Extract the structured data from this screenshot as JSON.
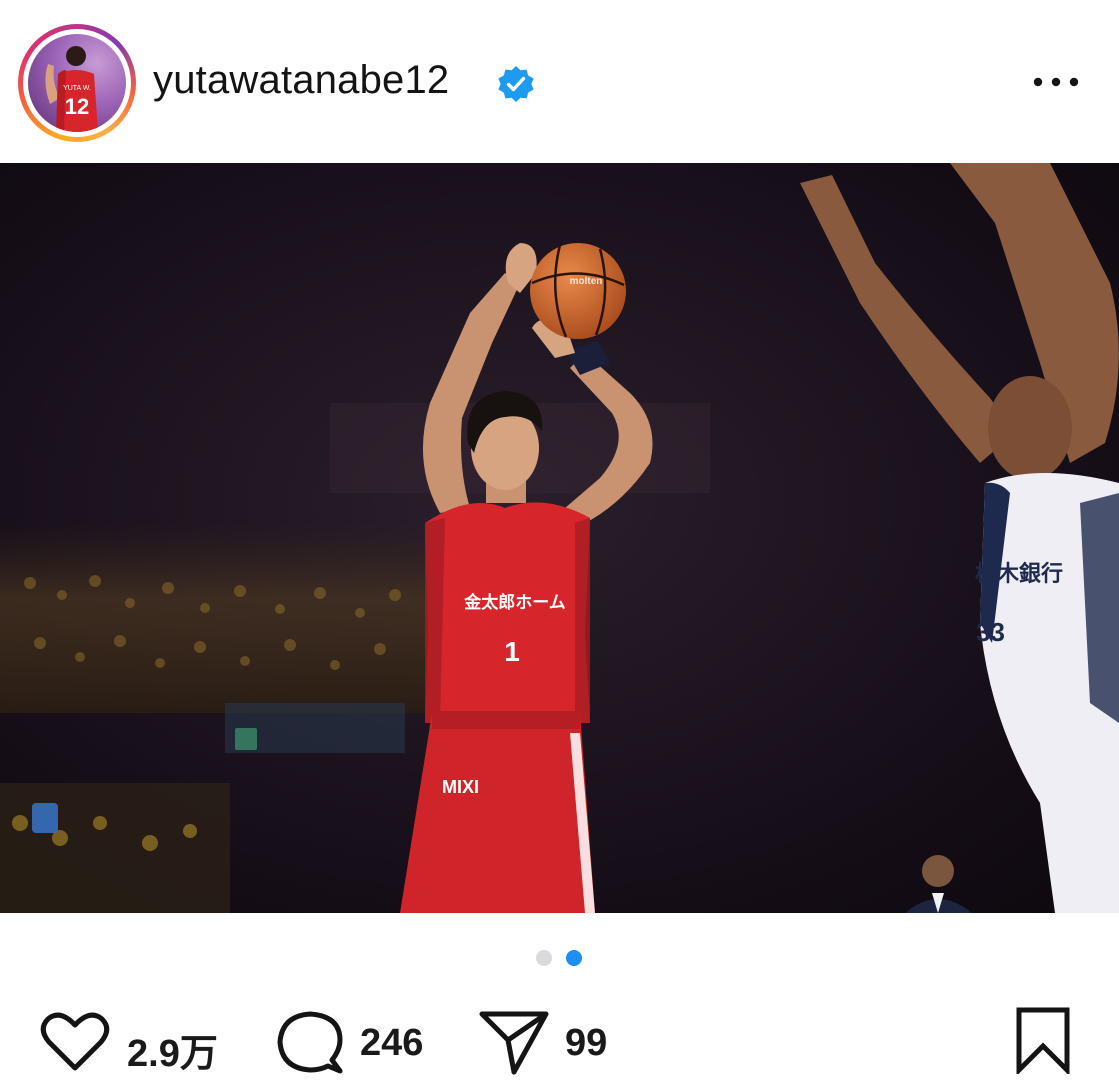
{
  "post": {
    "username": "yutawatanabe12",
    "verified": true,
    "avatar": {
      "jersey_name": "YUTA W.",
      "jersey_number": "12"
    },
    "photo": {
      "alt": "",
      "jersey_number": "1",
      "sponsor_text": "金太郎ホーム",
      "ball_brand": "molten",
      "shorts_text": "MIXI",
      "opponent_jersey_text": "栃木銀行",
      "opponent_number": "33"
    },
    "carousel": {
      "count": 2,
      "active_index": 1
    },
    "likes": "2.9万",
    "comments": "246",
    "shares": "99"
  },
  "icons": {
    "verified": "verified-badge-icon",
    "more": "more-options-icon",
    "like": "heart-icon",
    "comment": "comment-bubble-icon",
    "share": "paper-plane-icon",
    "save": "bookmark-icon"
  },
  "colors": {
    "verified": "#1d9bf0",
    "active_dot": "#1d8ff2",
    "inactive_dot": "#d9d9de",
    "jersey": "#d6262b"
  }
}
